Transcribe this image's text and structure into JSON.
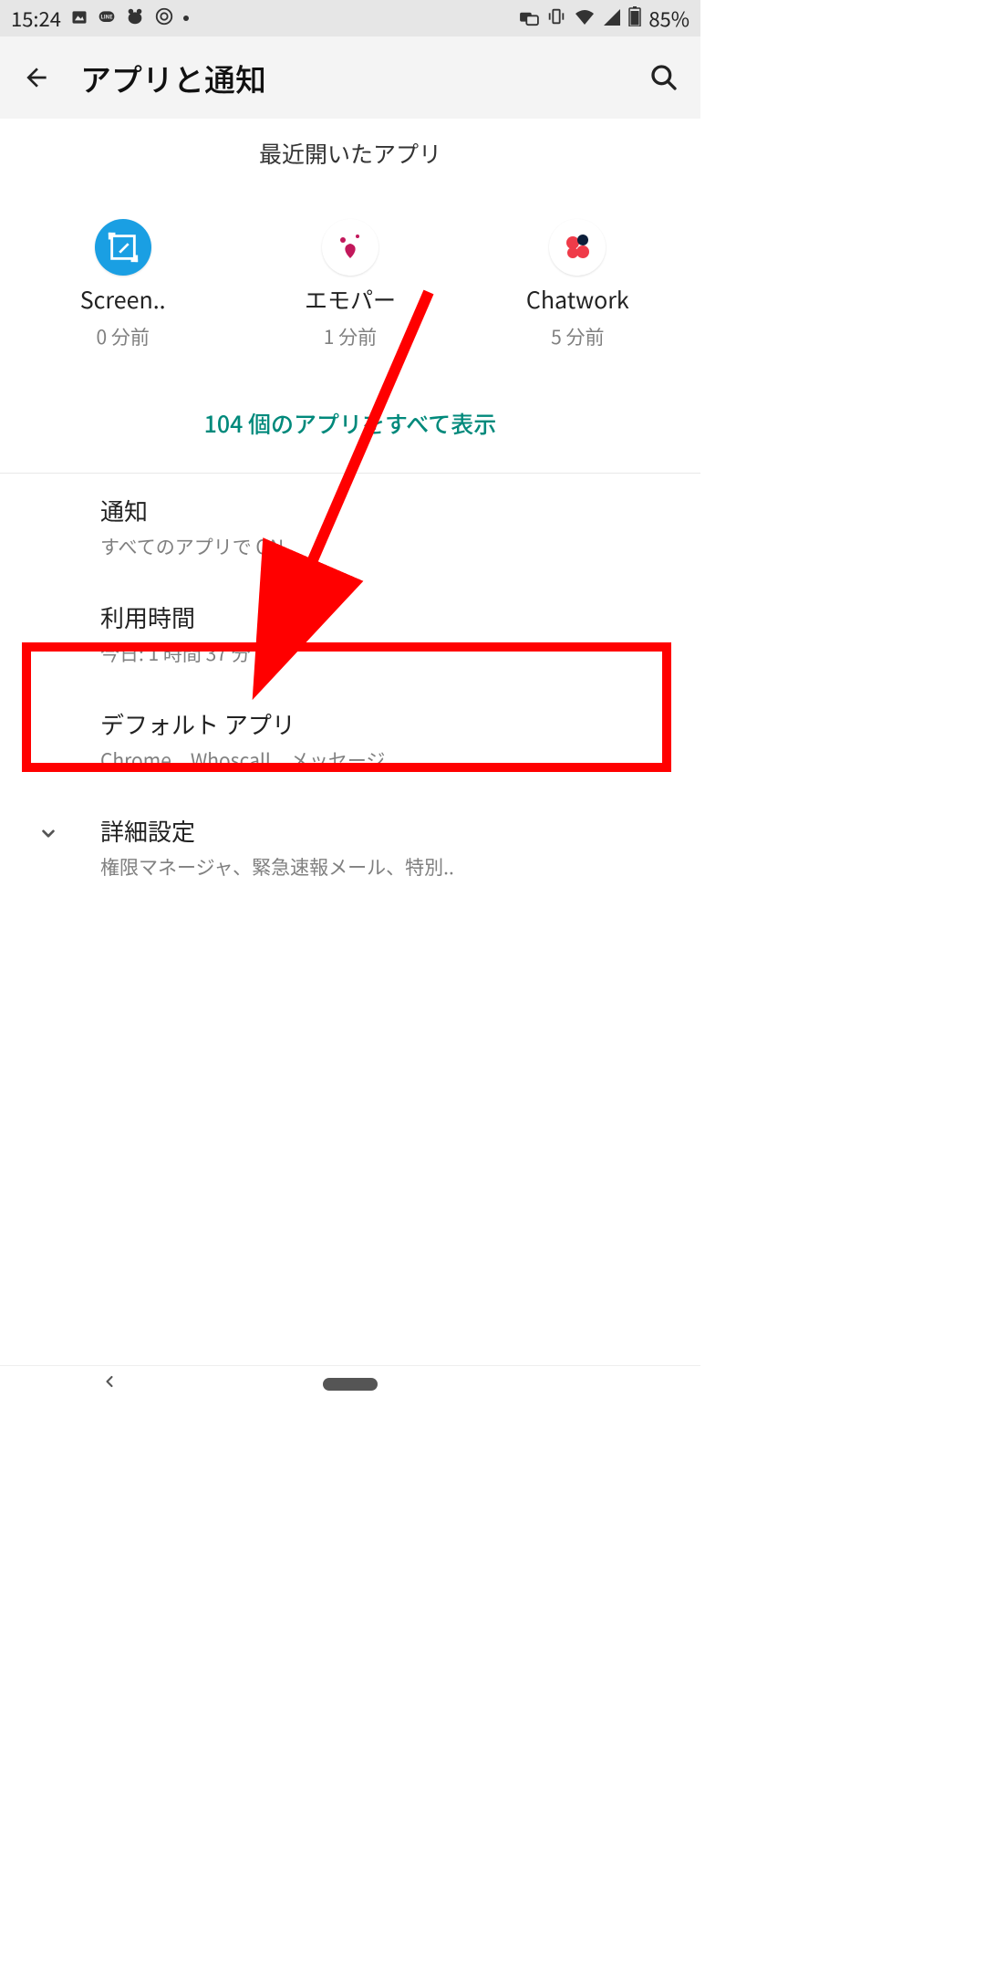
{
  "statusbar": {
    "time": "15:24",
    "battery_pct": "85%"
  },
  "header": {
    "title": "アプリと通知"
  },
  "recent": {
    "heading": "最近開いたアプリ",
    "apps": [
      {
        "name": "Screen..",
        "time": "0 分前"
      },
      {
        "name": "エモパー",
        "time": "1 分前"
      },
      {
        "name": "Chatwork",
        "time": "5 分前"
      }
    ],
    "see_all": "104 個のアプリをすべて表示"
  },
  "settings": {
    "notifications": {
      "title": "通知",
      "sub": "すべてのアプリで ON"
    },
    "usage": {
      "title": "利用時間",
      "sub": "今日: 1 時間 37 分"
    },
    "default_apps": {
      "title": "デフォルト アプリ",
      "sub": "Chrome、Whoscall、メッセージ"
    },
    "advanced": {
      "title": "詳細設定",
      "sub": "権限マネージャ、緊急速報メール、特別.."
    }
  },
  "annotation": {
    "highlighted_item": "default_apps"
  }
}
